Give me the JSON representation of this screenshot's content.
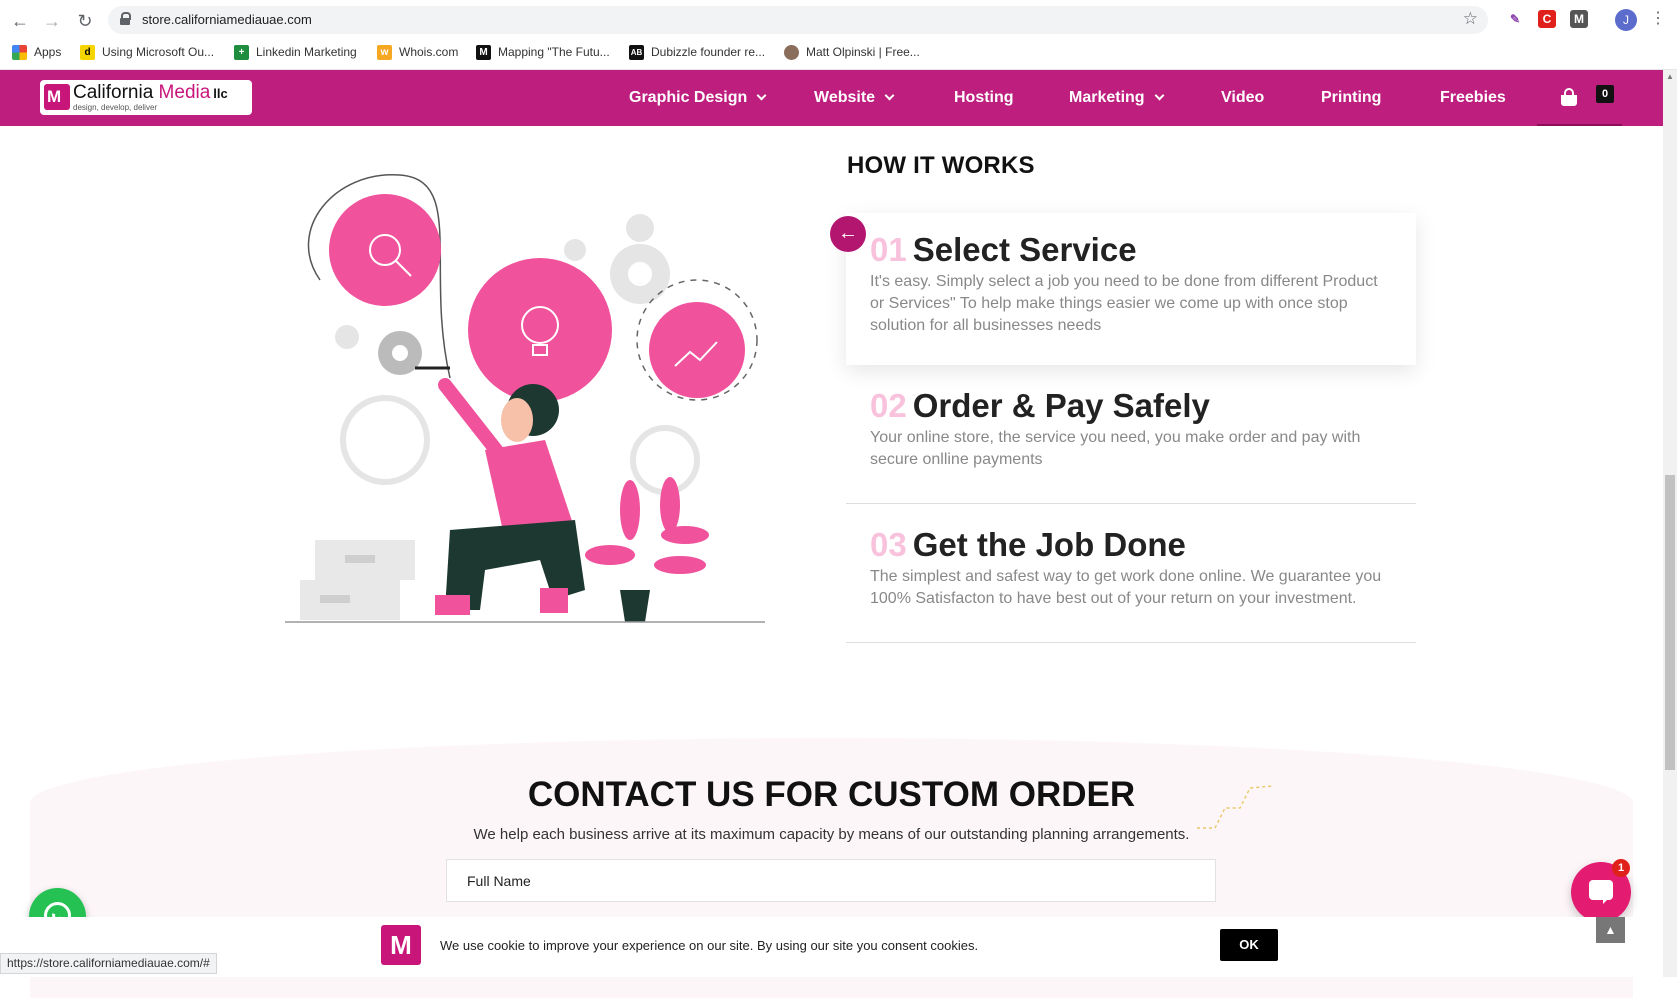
{
  "browser": {
    "url": "store.californiamediauae.com",
    "profile_initial": "J",
    "bookmarks": [
      {
        "label": "Apps"
      },
      {
        "label": "Using Microsoft Ou..."
      },
      {
        "label": "Linkedin Marketing"
      },
      {
        "label": "Whois.com"
      },
      {
        "label": "Mapping \"The Futu..."
      },
      {
        "label": "Dubizzle founder re..."
      },
      {
        "label": "Matt Olpinski | Free..."
      }
    ],
    "status_url": "https://store.californiamediauae.com/#"
  },
  "header": {
    "logo": {
      "brand_a": "California",
      "brand_b": "Media",
      "suffix": "llc",
      "tagline": "design, develop, deliver"
    },
    "nav": [
      {
        "label": "Graphic Design",
        "dropdown": true
      },
      {
        "label": "Website",
        "dropdown": true
      },
      {
        "label": "Hosting",
        "dropdown": false
      },
      {
        "label": "Marketing",
        "dropdown": true
      },
      {
        "label": "Video",
        "dropdown": false
      },
      {
        "label": "Printing",
        "dropdown": false
      },
      {
        "label": "Freebies",
        "dropdown": false
      }
    ],
    "cart_count": "0"
  },
  "how_it_works": {
    "title": "HOW IT WORKS",
    "steps": [
      {
        "num": "01",
        "title": "Select Service",
        "desc": "It's easy. Simply select a job you need to be done from different Product or Services\" To help make things easier we come up with once stop solution for all businesses needs"
      },
      {
        "num": "02",
        "title": "Order & Pay Safely",
        "desc": "Your online store, the service you need, you make order and pay with secure onlline payments"
      },
      {
        "num": "03",
        "title": "Get the Job Done",
        "desc": "The simplest and safest way to get work done online. We guarantee you 100% Satisfacton to have best out of your return on your investment."
      }
    ]
  },
  "contact": {
    "title": "CONTACT US FOR CUSTOM ORDER",
    "subtitle": "We help each business arrive at its maximum capacity by means of our outstanding planning arrangements.",
    "full_name_placeholder": "Full Name"
  },
  "cookie": {
    "text": "We use cookie to improve your experience on our site. By using our site you consent cookies.",
    "ok_label": "OK"
  },
  "chat": {
    "badge": "1"
  },
  "colors": {
    "brand": "#be1f7f",
    "accent_pink": "#f0529c",
    "step_number": "#f8c2dd"
  }
}
